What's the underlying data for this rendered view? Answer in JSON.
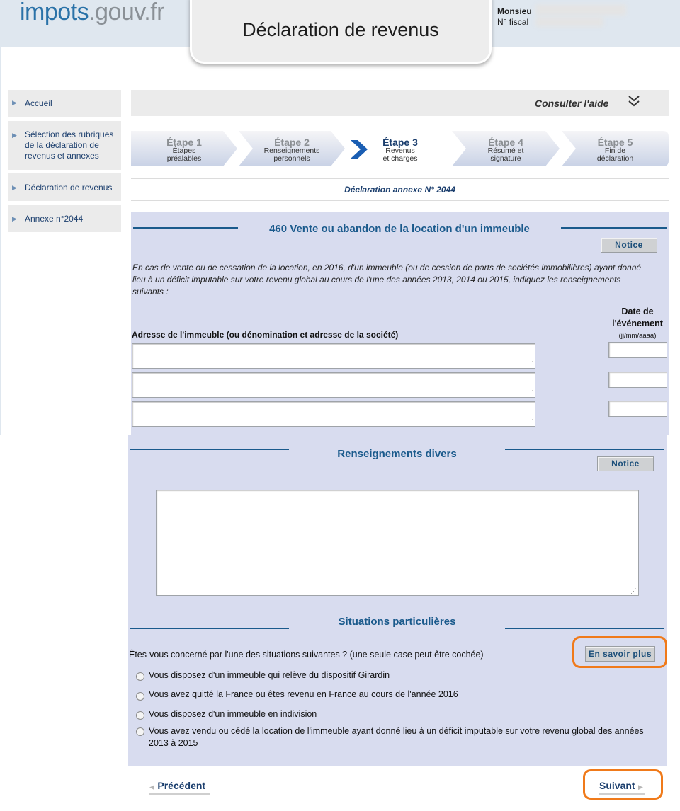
{
  "header": {
    "logo_part1": "impots",
    "logo_part2": ".gouv.fr",
    "title": "Déclaration de revenus",
    "user_label": "Monsieu",
    "fiscal_label": "N° fiscal"
  },
  "sidebar": {
    "items": [
      {
        "label": "Accueil"
      },
      {
        "label": "Sélection des rubriques de la déclaration de revenus et annexes"
      },
      {
        "label": "Déclaration de revenus"
      },
      {
        "label": "Annexe n°2044"
      }
    ]
  },
  "help": {
    "label": "Consulter l'aide"
  },
  "steps": [
    {
      "title": "Étape 1",
      "sub1": "Étapes",
      "sub2": "préalables"
    },
    {
      "title": "Étape 2",
      "sub1": "Renseignements",
      "sub2": "personnels"
    },
    {
      "title": "Étape 3",
      "sub1": "Revenus",
      "sub2": "et charges"
    },
    {
      "title": "Étape 4",
      "sub1": "Résumé et",
      "sub2": "signature"
    },
    {
      "title": "Étape 5",
      "sub1": "Fin de",
      "sub2": "déclaration"
    }
  ],
  "annex_title": "Déclaration annexe N° 2044",
  "section460": {
    "title": "460  Vente ou abandon de la location d'un immeuble",
    "notice": "Notice",
    "intro": "En cas de vente ou de cessation de la location, en 2016, d'un immeuble (ou de cession de parts de sociétés immobilières) ayant donné lieu à un déficit imputable sur votre revenu global au cours de l'une des années 2013, 2014 ou 2015, indiquez les renseignements suivants :",
    "address_label": "Adresse de l'immeuble (ou dénomination et adresse de la société)",
    "date_label_1": "Date de",
    "date_label_2": "l'événement",
    "date_format": "(jj/mm/aaaa)"
  },
  "misc": {
    "title": "Renseignements divers",
    "notice": "Notice"
  },
  "situations": {
    "title": "Situations particulières",
    "question": "Êtes-vous concerné par l'une des situations suivantes ? (une seule case peut être cochée)",
    "learn_more": "En savoir plus",
    "options": [
      {
        "line1": "Vous disposez d'un immeuble qui relève du dispositif Girardin"
      },
      {
        "line1": "Vous avez quitté la France ou êtes revenu en France au cours de l'année 2016"
      },
      {
        "line1": "Vous disposez d'un immeuble en indivision"
      },
      {
        "line1": "Vous avez vendu ou cédé la location de l'immeuble ayant donné lieu à un déficit imputable sur votre revenu global des années",
        "line2": "2013 à 2015"
      }
    ]
  },
  "nav": {
    "previous": "Précédent",
    "next": "Suivant"
  },
  "colors": {
    "accent": "#1a5a8c",
    "panel": "#d8dcef",
    "highlight": "#f07a1a"
  }
}
